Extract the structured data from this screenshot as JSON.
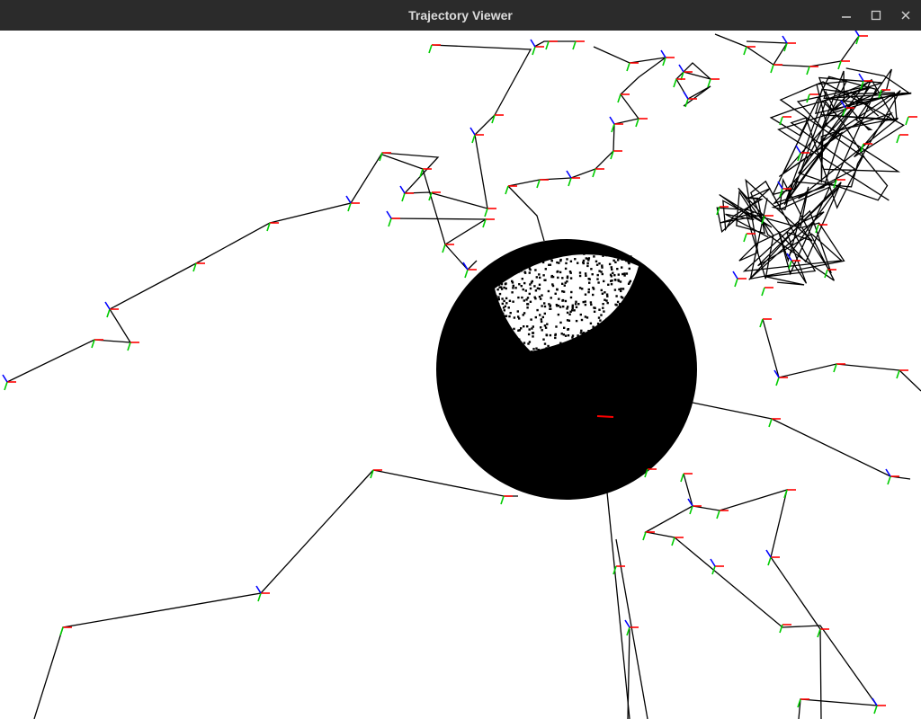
{
  "window": {
    "title": "Trajectory Viewer",
    "controls": {
      "minimize_icon": "minimize-icon",
      "maximize_icon": "maximize-icon",
      "close_icon": "close-icon"
    }
  },
  "scene": {
    "background_color": "#ffffff",
    "trajectory_color": "#000000",
    "sphere_color": "#000000",
    "axis_colors": {
      "x": "#ff0000",
      "y": "#00cc00",
      "z": "#0000ff"
    }
  }
}
